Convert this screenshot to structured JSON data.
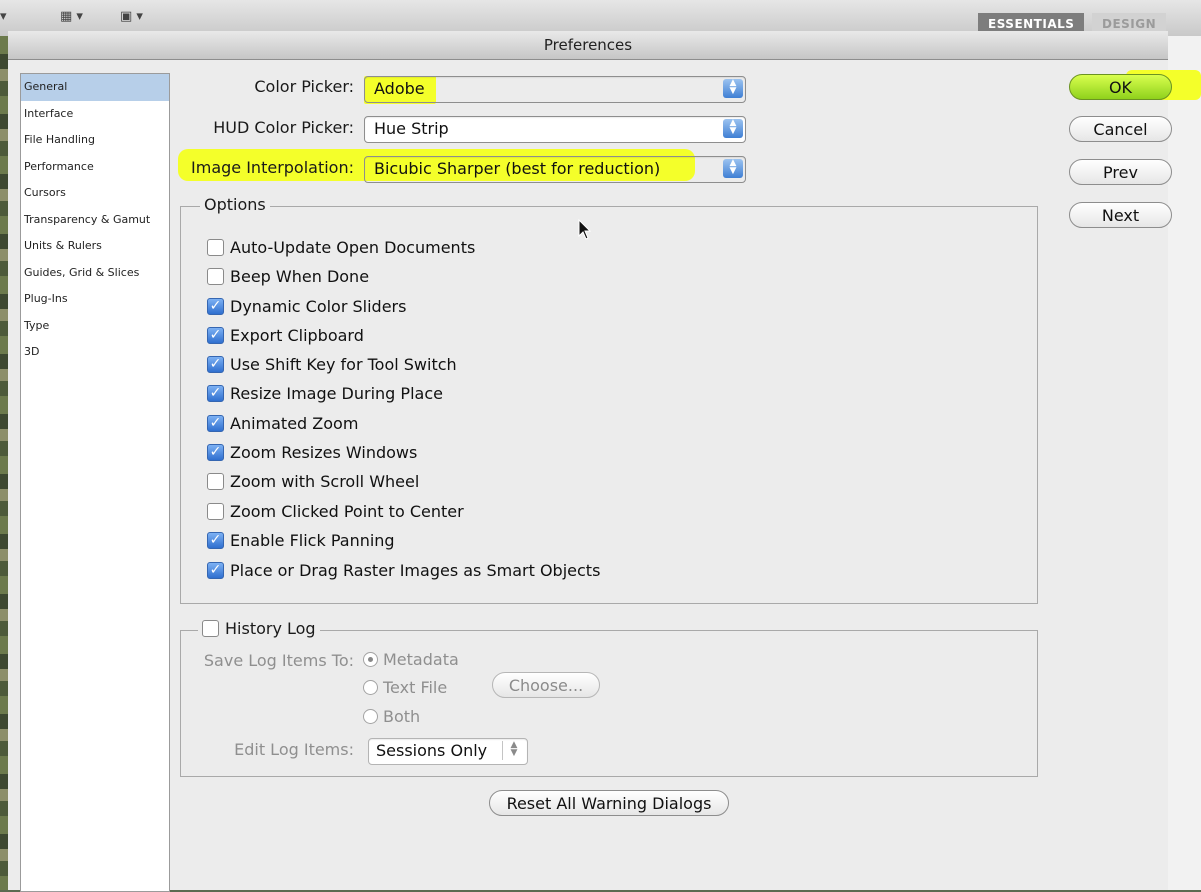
{
  "app": {
    "workspace_tabs": [
      "ESSENTIALS",
      "DESIGN"
    ]
  },
  "dialog": {
    "title": "Preferences"
  },
  "sidebar": {
    "items": [
      {
        "label": "General",
        "selected": true
      },
      {
        "label": "Interface"
      },
      {
        "label": "File Handling"
      },
      {
        "label": "Performance"
      },
      {
        "label": "Cursors"
      },
      {
        "label": "Transparency & Gamut"
      },
      {
        "label": "Units & Rulers"
      },
      {
        "label": "Guides, Grid & Slices"
      },
      {
        "label": "Plug-Ins"
      },
      {
        "label": "Type"
      },
      {
        "label": "3D"
      }
    ]
  },
  "general": {
    "color_picker": {
      "label": "Color Picker:",
      "value": "Adobe"
    },
    "hud_color_picker": {
      "label": "HUD Color Picker:",
      "value": "Hue Strip"
    },
    "image_interpolation": {
      "label": "Image Interpolation:",
      "value": "Bicubic Sharper (best for reduction)"
    },
    "options": {
      "title": "Options",
      "items": [
        {
          "label": "Auto-Update Open Documents",
          "checked": false
        },
        {
          "label": "Beep When Done",
          "checked": false
        },
        {
          "label": "Dynamic Color Sliders",
          "checked": true
        },
        {
          "label": "Export Clipboard",
          "checked": true
        },
        {
          "label": "Use Shift Key for Tool Switch",
          "checked": true
        },
        {
          "label": "Resize Image During Place",
          "checked": true
        },
        {
          "label": "Animated Zoom",
          "checked": true
        },
        {
          "label": "Zoom Resizes Windows",
          "checked": true
        },
        {
          "label": "Zoom with Scroll Wheel",
          "checked": false
        },
        {
          "label": "Zoom Clicked Point to Center",
          "checked": false
        },
        {
          "label": "Enable Flick Panning",
          "checked": true
        },
        {
          "label": "Place or Drag Raster Images as Smart Objects",
          "checked": true
        }
      ]
    },
    "history_log": {
      "title": "History Log",
      "checked": false,
      "save_label": "Save Log Items To:",
      "radio_options": [
        {
          "label": "Metadata",
          "selected": true
        },
        {
          "label": "Text File",
          "selected": false
        },
        {
          "label": "Both",
          "selected": false
        }
      ],
      "choose_label": "Choose...",
      "edit_label": "Edit Log Items:",
      "edit_value": "Sessions Only"
    },
    "reset_warnings_label": "Reset All Warning Dialogs"
  },
  "buttons": {
    "ok": "OK",
    "cancel": "Cancel",
    "prev": "Prev",
    "next": "Next"
  },
  "colors": {
    "highlight": "#f4ff2a",
    "selection": "#b7cfe9",
    "ok_button": "#a8e22a"
  }
}
